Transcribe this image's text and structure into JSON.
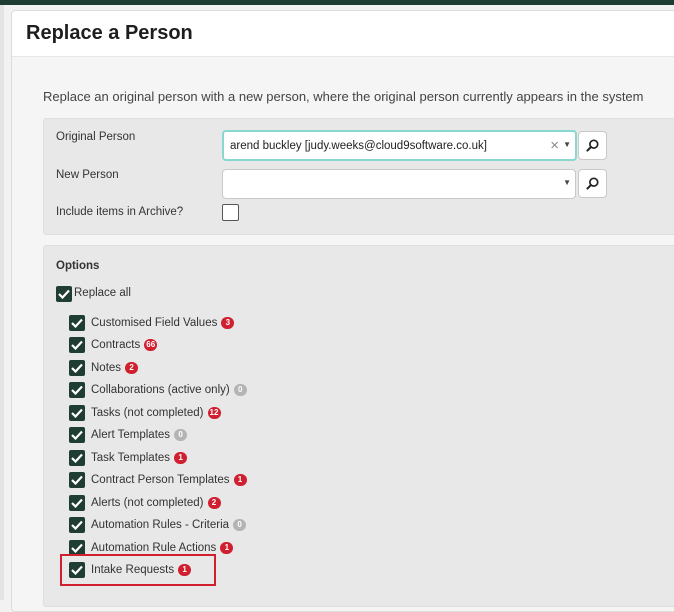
{
  "page": {
    "title": "Replace a Person",
    "description": "Replace an original person with a new person, where the original person currently appears in the system"
  },
  "form": {
    "original_person_label": "Original Person",
    "original_person_value": "arend buckley [judy.weeks@cloud9software.co.uk]",
    "new_person_label": "New Person",
    "new_person_value": "",
    "include_archive_label": "Include items in Archive?",
    "include_archive_checked": false
  },
  "options": {
    "title": "Options",
    "replace_all_label": "Replace all",
    "items": [
      {
        "label": "Customised Field Values",
        "count": "3",
        "tone": "red"
      },
      {
        "label": "Contracts",
        "count": "66",
        "tone": "red"
      },
      {
        "label": "Notes",
        "count": "2",
        "tone": "red"
      },
      {
        "label": "Collaborations (active only)",
        "count": "0",
        "tone": "grey"
      },
      {
        "label": "Tasks (not completed)",
        "count": "12",
        "tone": "red"
      },
      {
        "label": "Alert Templates",
        "count": "0",
        "tone": "grey"
      },
      {
        "label": "Task Templates",
        "count": "1",
        "tone": "red"
      },
      {
        "label": "Contract Person Templates",
        "count": "1",
        "tone": "red"
      },
      {
        "label": "Alerts (not completed)",
        "count": "2",
        "tone": "red"
      },
      {
        "label": "Automation Rules - Criteria",
        "count": "0",
        "tone": "grey"
      },
      {
        "label": "Automation Rule Actions",
        "count": "1",
        "tone": "red"
      },
      {
        "label": "Intake Requests",
        "count": "1",
        "tone": "red"
      }
    ]
  },
  "colors": {
    "checkbox": "#1f3d33",
    "badge_red": "#d01f2f",
    "badge_grey": "#b4b4b4",
    "highlight": "#d01f2f"
  }
}
